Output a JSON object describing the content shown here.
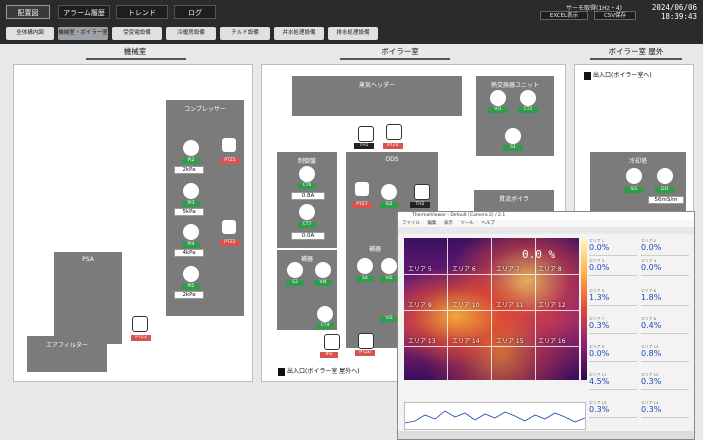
{
  "nav": {
    "tabs": [
      "配置図",
      "アラーム履歴",
      "トレンド",
      "ログ"
    ]
  },
  "header": {
    "server": "サーモ取得(1Hz・4)",
    "excel_label": "EXCEL表示",
    "csv_label": "CSV保存",
    "date": "2024/06/06",
    "time": "18:39:43"
  },
  "subnav": {
    "tabs": [
      "全体構内図",
      "機械室・ボイラー室",
      "受変電設備",
      "冷暖房設備",
      "チルド設備",
      "井水処理設備",
      "排水処理設備"
    ]
  },
  "areas": {
    "machine_room": "機械室",
    "boiler_room": "ボイラー室",
    "boiler_outside": "ボイラー室 屋外"
  },
  "compressor": {
    "title": "コンプレッサー",
    "sensors": [
      {
        "tag": "PI2",
        "value": "2kPa"
      },
      {
        "tag": "PI3",
        "value": "5kPa"
      },
      {
        "tag": "PI4",
        "value": "4kPa"
      },
      {
        "tag": "PI5",
        "value": "2kPa"
      }
    ],
    "cams": [
      "PTZ1",
      "PTZ2"
    ]
  },
  "psa": {
    "title": "PSA"
  },
  "air_filter": {
    "title": "エアフィルター",
    "cam": "PTZ3"
  },
  "steam_header": {
    "title": "蒸気ヘッダー"
  },
  "th1": {
    "tag": "TH1",
    "cam": "PTZ4"
  },
  "control_panel": {
    "title": "制御盤",
    "ct6": {
      "tag": "CT6",
      "value": "0.8A"
    },
    "ct7": {
      "tag": "CT7",
      "value": "0.0A"
    }
  },
  "ods": {
    "title": "ODS",
    "tags": [
      "PTZ7",
      "SI2",
      "TH2"
    ]
  },
  "water_tank": {
    "title": "補器",
    "tags": [
      "S3",
      "VI4"
    ]
  },
  "boiler_sub": {
    "title": "補器",
    "tags": [
      "S4",
      "VI2",
      "VI3",
      "CT4"
    ]
  },
  "heat_exchanger": {
    "title": "熱交換器ユニット",
    "tags": [
      "VI1",
      "CT1",
      "S1"
    ]
  },
  "ip2": {
    "tag": "IP2"
  },
  "ptz6": {
    "tag": "PTZ6"
  },
  "steam_boiler": {
    "title": "貫流ボイラ"
  },
  "cooling_tower": {
    "title": "冷却塔",
    "tags": [
      "SI1",
      "DI1"
    ],
    "value": "56mS/m"
  },
  "doors": {
    "outside_entrance": "出入口(ボイラー室へ)",
    "bottom_entrance": "出入口(ボイラー室 屋外へ)"
  },
  "thermal_window": {
    "title": "ThermalViewer - Default (Camera 2) / 2.1",
    "menu": [
      "ファイル",
      "編集",
      "表示",
      "ツール",
      "ヘルプ"
    ],
    "center_temp": "0.0 %",
    "zones": [
      "エリア 5",
      "エリア 6",
      "エリア 7",
      "エリア 8",
      "エリア 9",
      "エリア 10",
      "エリア 11",
      "エリア 12",
      "エリア 13",
      "エリア 14",
      "エリア 15",
      "エリア 16"
    ],
    "readouts": [
      {
        "label": "エリア 1",
        "value": "0.0%"
      },
      {
        "label": "エリア 2",
        "value": "0.0%"
      },
      {
        "label": "エリア 3",
        "value": "0.0%"
      },
      {
        "label": "エリア 4",
        "value": "0.0%"
      },
      {
        "label": "エリア 5",
        "value": "1.3%"
      },
      {
        "label": "エリア 6",
        "value": "1.8%"
      },
      {
        "label": "エリア 7",
        "value": "0.3%"
      },
      {
        "label": "エリア 8",
        "value": "0.4%"
      },
      {
        "label": "エリア 9",
        "value": "0.0%"
      },
      {
        "label": "エリア 10",
        "value": "0.8%"
      },
      {
        "label": "エリア 11",
        "value": "4.5%"
      },
      {
        "label": "エリア 12",
        "value": "0.3%"
      },
      {
        "label": "エリア 13",
        "value": "0.3%"
      },
      {
        "label": "エリア 14",
        "value": "0.3%"
      }
    ]
  },
  "colors": {
    "green": "#2e9e4a",
    "red": "#d9534f",
    "box": "#7b7b7b",
    "header": "#2b2b2b"
  }
}
